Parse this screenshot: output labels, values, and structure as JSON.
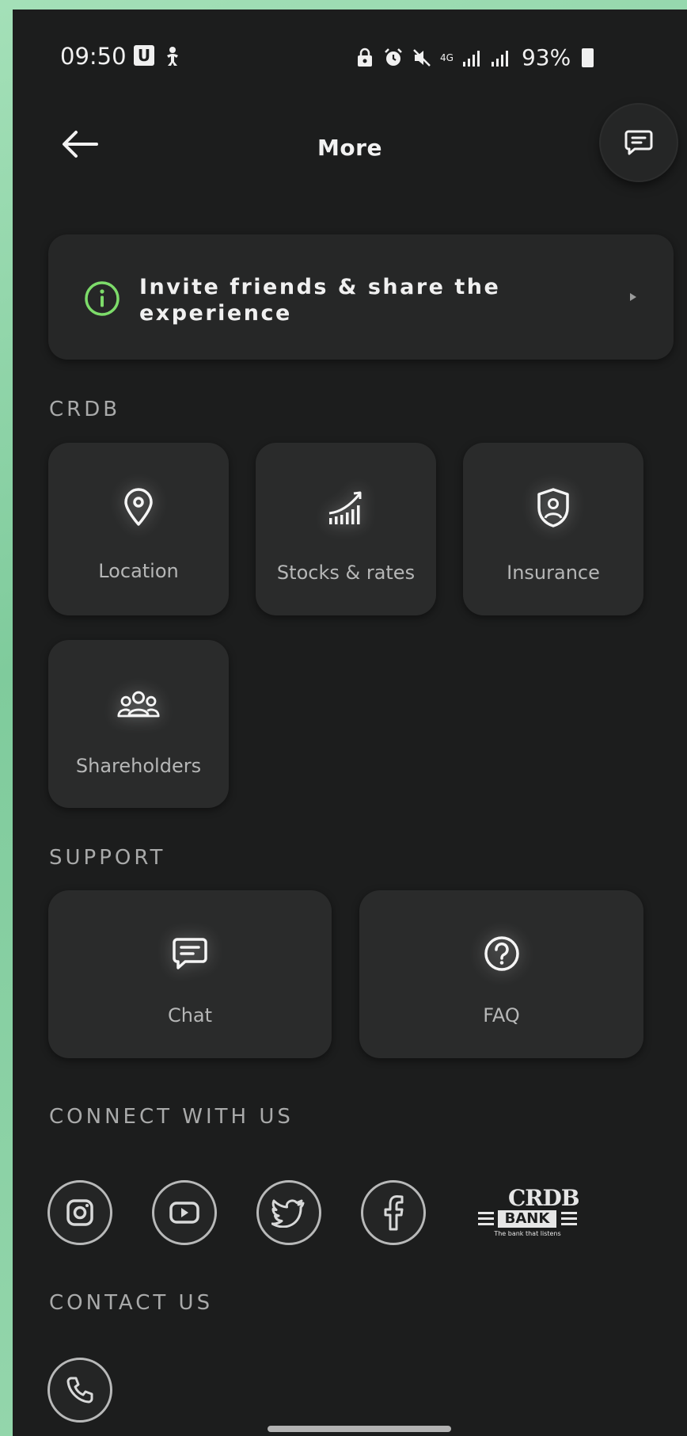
{
  "status_bar": {
    "time": "09:50",
    "u_badge": "U",
    "network": "4G",
    "battery": "93%"
  },
  "header": {
    "title": "More"
  },
  "invite": {
    "text": "Invite friends & share the experience"
  },
  "sections": {
    "crdb": "CRDB",
    "support": "SUPPORT",
    "connect": "CONNECT WITH US",
    "contact": "CONTACT US"
  },
  "crdb_tiles": [
    {
      "label": "Location",
      "icon": "location-pin-icon"
    },
    {
      "label": "Stocks & rates",
      "icon": "stocks-chart-icon"
    },
    {
      "label": "Insurance",
      "icon": "insurance-shield-icon"
    },
    {
      "label": "Shareholders",
      "icon": "shareholders-group-icon"
    }
  ],
  "support_tiles": [
    {
      "label": "Chat",
      "icon": "chat-icon"
    },
    {
      "label": "FAQ",
      "icon": "question-icon"
    }
  ],
  "social": [
    "instagram-icon",
    "youtube-icon",
    "twitter-icon",
    "facebook-icon"
  ],
  "logo": {
    "brand": "CRDB",
    "bank": "BANK",
    "tagline": "The bank that listens"
  },
  "colors": {
    "screen_bg": "#1c1d1d",
    "tile_bg": "#2a2b2b",
    "accent_green": "#7ddc6a",
    "text_muted": "#b6b7b7"
  }
}
